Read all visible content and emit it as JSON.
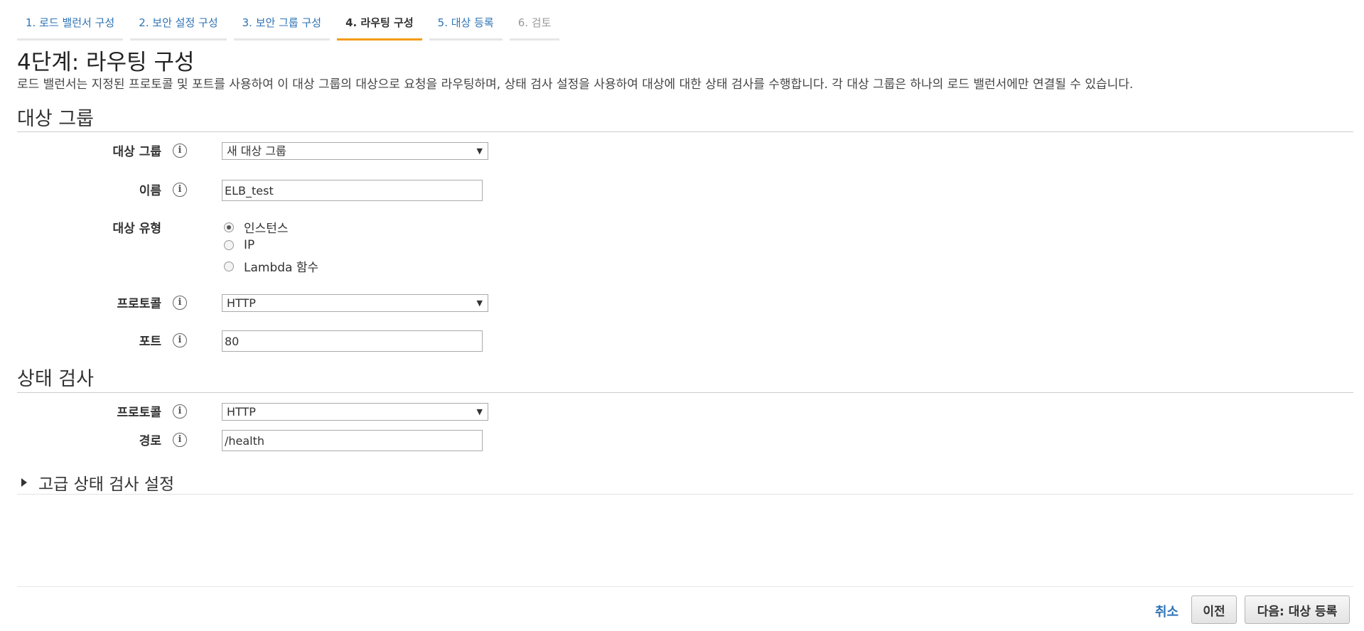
{
  "steps": [
    {
      "label": "1. 로드 밸런서 구성"
    },
    {
      "label": "2. 보안 설정 구성"
    },
    {
      "label": "3. 보안 그룹 구성"
    },
    {
      "label": "4. 라우팅 구성"
    },
    {
      "label": "5. 대상 등록"
    },
    {
      "label": "6. 검토"
    }
  ],
  "page": {
    "title": "4단계: 라우팅 구성",
    "description": "로드 밸런서는 지정된 프로토콜 및 포트를 사용하여 이 대상 그룹의 대상으로 요청을 라우팅하며, 상태 검사 설정을 사용하여 대상에 대한 상태 검사를 수행합니다. 각 대상 그룹은 하나의 로드 밸런서에만 연결될 수 있습니다."
  },
  "target_group": {
    "section_title": "대상 그룹",
    "group_label": "대상 그룹",
    "group_value": "새 대상 그룹",
    "name_label": "이름",
    "name_value": "ELB_test",
    "type_label": "대상 유형",
    "type_options": [
      "인스턴스",
      "IP",
      "Lambda 함수"
    ],
    "type_selected": "인스턴스",
    "protocol_label": "프로토콜",
    "protocol_value": "HTTP",
    "port_label": "포트",
    "port_value": "80"
  },
  "health_check": {
    "section_title": "상태 검사",
    "protocol_label": "프로토콜",
    "protocol_value": "HTTP",
    "path_label": "경로",
    "path_value": "/health",
    "advanced_label": "고급 상태 검사 설정"
  },
  "footer": {
    "cancel_label": "취소",
    "previous_label": "이전",
    "next_label": "다음: 대상 등록"
  },
  "icons": {
    "info": "i"
  },
  "colors": {
    "accent": "#f39c12",
    "link": "#2d73b6"
  }
}
